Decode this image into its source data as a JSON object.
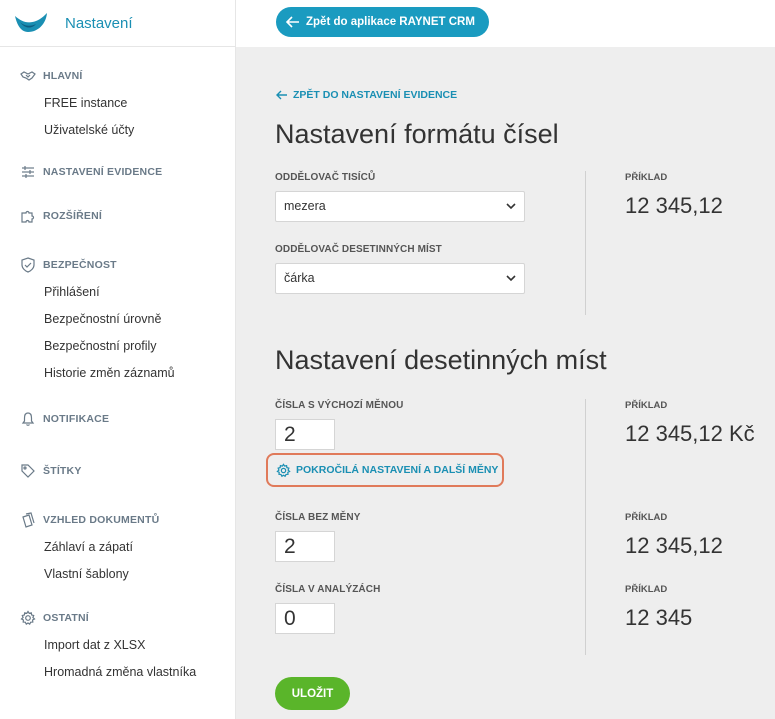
{
  "sidebar": {
    "title": "Nastavení",
    "sections": [
      {
        "label": "HLAVNÍ",
        "icon": "handshake-icon",
        "items": [
          "FREE instance",
          "Uživatelské účty"
        ]
      },
      {
        "label": "NASTAVENÍ EVIDENCE",
        "icon": "sliders-icon",
        "items": []
      },
      {
        "label": "ROZŠÍŘENÍ",
        "icon": "puzzle-icon",
        "items": []
      },
      {
        "label": "BEZPEČNOST",
        "icon": "shield-check-icon",
        "items": [
          "Přihlášení",
          "Bezpečnostní úrovně",
          "Bezpečnostní profily",
          "Historie změn záznamů"
        ]
      },
      {
        "label": "NOTIFIKACE",
        "icon": "bell-icon",
        "items": []
      },
      {
        "label": "ŠTÍTKY",
        "icon": "tag-icon",
        "items": []
      },
      {
        "label": "VZHLED DOKUMENTŮ",
        "icon": "documents-icon",
        "items": [
          "Záhlaví a zápatí",
          "Vlastní šablony"
        ]
      },
      {
        "label": "OSTATNÍ",
        "icon": "gear-icon",
        "items": [
          "Import dat z XLSX",
          "Hromadná změna vlastníka"
        ]
      }
    ]
  },
  "topbar": {
    "back_app": "Zpět do aplikace RAYNET CRM"
  },
  "main": {
    "back_link": "ZPĚT DO NASTAVENÍ EVIDENCE",
    "number_format": {
      "title": "Nastavení formátu čísel",
      "thousands_label": "ODDĚLOVAČ TISÍCŮ",
      "thousands_value": "mezera",
      "decimal_label": "ODDĚLOVAČ DESETINNÝCH MÍST",
      "decimal_value": "čárka",
      "example_label": "PŘÍKLAD",
      "example_value": "12 345,12"
    },
    "decimals": {
      "title": "Nastavení desetinných míst",
      "default_currency_label": "ČÍSLA S VÝCHOZÍ MĚNOU",
      "default_currency_value": "2",
      "default_currency_example_label": "PŘÍKLAD",
      "default_currency_example": "12 345,12 Kč",
      "advanced_link": "POKROČILÁ NASTAVENÍ A DALŠÍ MĚNY",
      "no_currency_label": "ČÍSLA BEZ MĚNY",
      "no_currency_value": "2",
      "no_currency_example_label": "PŘÍKLAD",
      "no_currency_example": "12 345,12",
      "analytics_label": "ČÍSLA V ANALÝZÁCH",
      "analytics_value": "0",
      "analytics_example_label": "PŘÍKLAD",
      "analytics_example": "12 345"
    },
    "save_label": "ULOŽIT"
  },
  "colors": {
    "accent": "#1a8fb3",
    "button_blue": "#1a9bc0",
    "save_green": "#5ab52a",
    "highlight": "#e07a5a"
  }
}
